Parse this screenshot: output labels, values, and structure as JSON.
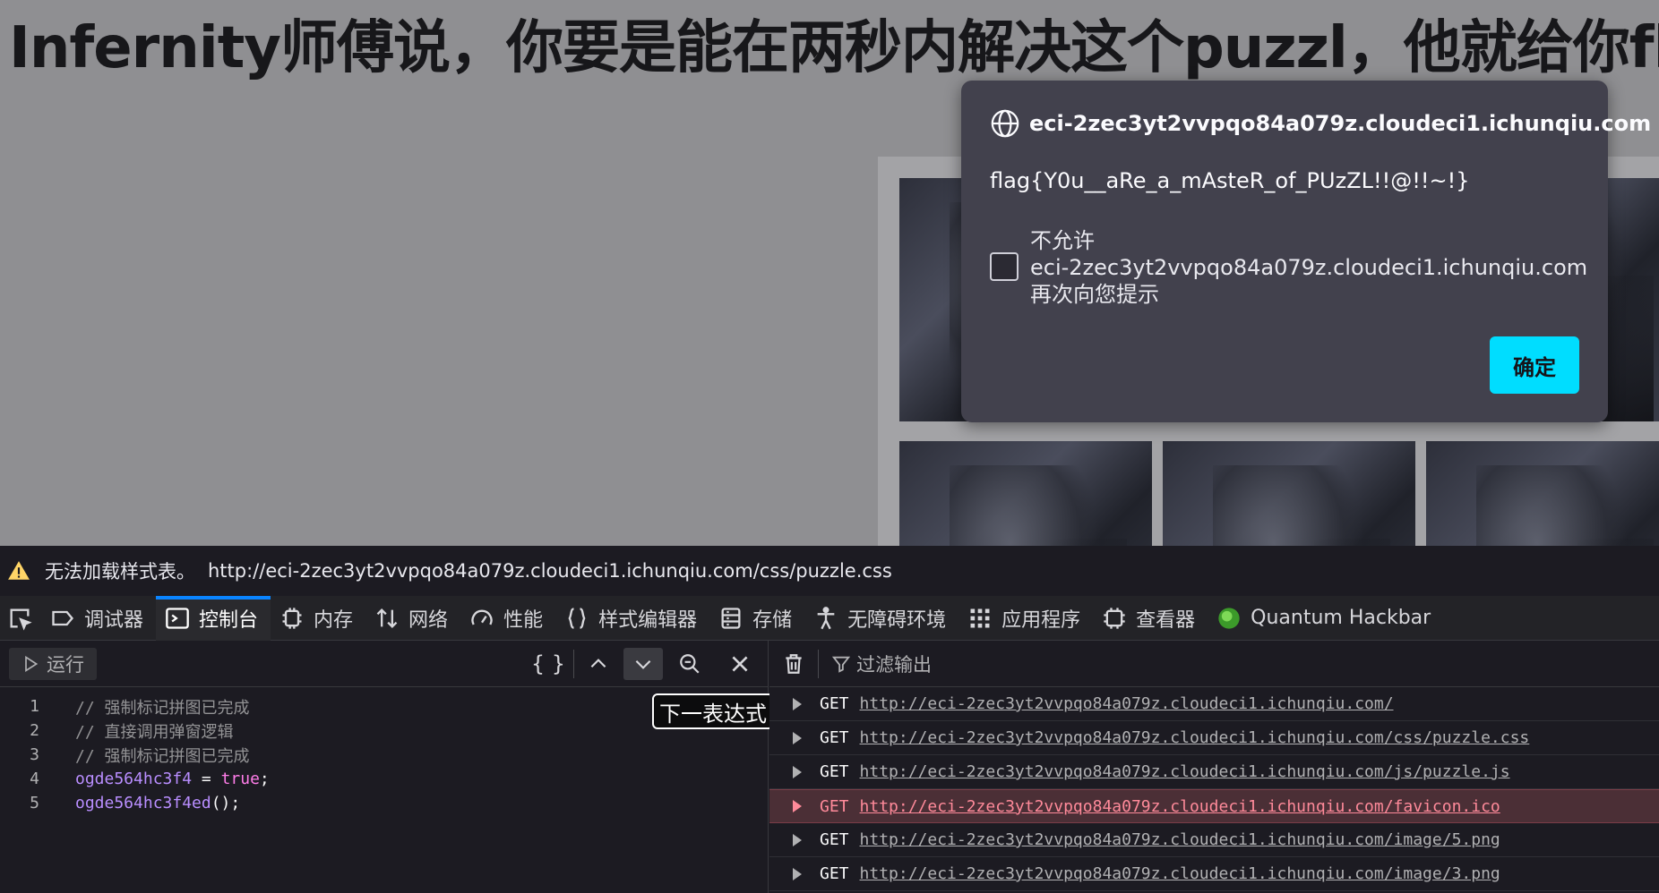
{
  "page": {
    "title": "Infernity师傅说，你要是能在两秒内解决这个puzzl，他就给你fla"
  },
  "alert": {
    "origin": "eci-2zec3yt2vvpqo84a079z.cloudeci1.ichunqiu.com",
    "message": "flag{Y0u__aRe_a_mAsteR_of_PUzZL!!@!!~!}",
    "checkbox_line1": "不允许",
    "checkbox_line2": "eci-2zec3yt2vvpqo84a079z.cloudeci1.ichunqiu.com",
    "checkbox_line3": "再次向您提示",
    "ok_label": "确定",
    "accent_color": "#00ddff"
  },
  "warning": {
    "text": "无法加载样式表。",
    "url": "http://eci-2zec3yt2vvpqo84a079z.cloudeci1.ichunqiu.com/css/puzzle.css"
  },
  "devtools": {
    "tabs": [
      {
        "label": "调试器",
        "icon": "debugger-icon"
      },
      {
        "label": "控制台",
        "icon": "console-icon",
        "active": true
      },
      {
        "label": "内存",
        "icon": "memory-icon"
      },
      {
        "label": "网络",
        "icon": "network-icon"
      },
      {
        "label": "性能",
        "icon": "performance-icon"
      },
      {
        "label": "样式编辑器",
        "icon": "style-editor-icon"
      },
      {
        "label": "存储",
        "icon": "storage-icon"
      },
      {
        "label": "无障碍环境",
        "icon": "accessibility-icon"
      },
      {
        "label": "应用程序",
        "icon": "application-icon"
      },
      {
        "label": "查看器",
        "icon": "inspector-icon"
      },
      {
        "label": "Quantum Hackbar",
        "icon": "hackbar-icon"
      }
    ],
    "editor": {
      "run_label": "运行",
      "pretty_print": "{ }",
      "tooltip": "下一表达式",
      "lines": [
        {
          "n": "1",
          "comment": "// 强制标记拼图已完成"
        },
        {
          "n": "2",
          "comment": "// 直接调用弹窗逻辑"
        },
        {
          "n": "3",
          "comment": "// 强制标记拼图已完成"
        },
        {
          "n": "4",
          "ident": "ogde564hc3f4",
          "op": " = ",
          "kw": "true",
          "end": ";"
        },
        {
          "n": "5",
          "ident": "ogde564hc3f4ed",
          "end": "();"
        }
      ]
    },
    "output": {
      "filter_placeholder": "过滤输出",
      "requests": [
        {
          "method": "GET",
          "url": "http://eci-2zec3yt2vvpqo84a079z.cloudeci1.ichunqiu.com/",
          "error": false
        },
        {
          "method": "GET",
          "url": "http://eci-2zec3yt2vvpqo84a079z.cloudeci1.ichunqiu.com/css/puzzle.css",
          "error": false
        },
        {
          "method": "GET",
          "url": "http://eci-2zec3yt2vvpqo84a079z.cloudeci1.ichunqiu.com/js/puzzle.js",
          "error": false
        },
        {
          "method": "GET",
          "url": "http://eci-2zec3yt2vvpqo84a079z.cloudeci1.ichunqiu.com/favicon.ico",
          "error": true
        },
        {
          "method": "GET",
          "url": "http://eci-2zec3yt2vvpqo84a079z.cloudeci1.ichunqiu.com/image/5.png",
          "error": false
        },
        {
          "method": "GET",
          "url": "http://eci-2zec3yt2vvpqo84a079z.cloudeci1.ichunqiu.com/image/3.png",
          "error": false
        }
      ]
    }
  }
}
